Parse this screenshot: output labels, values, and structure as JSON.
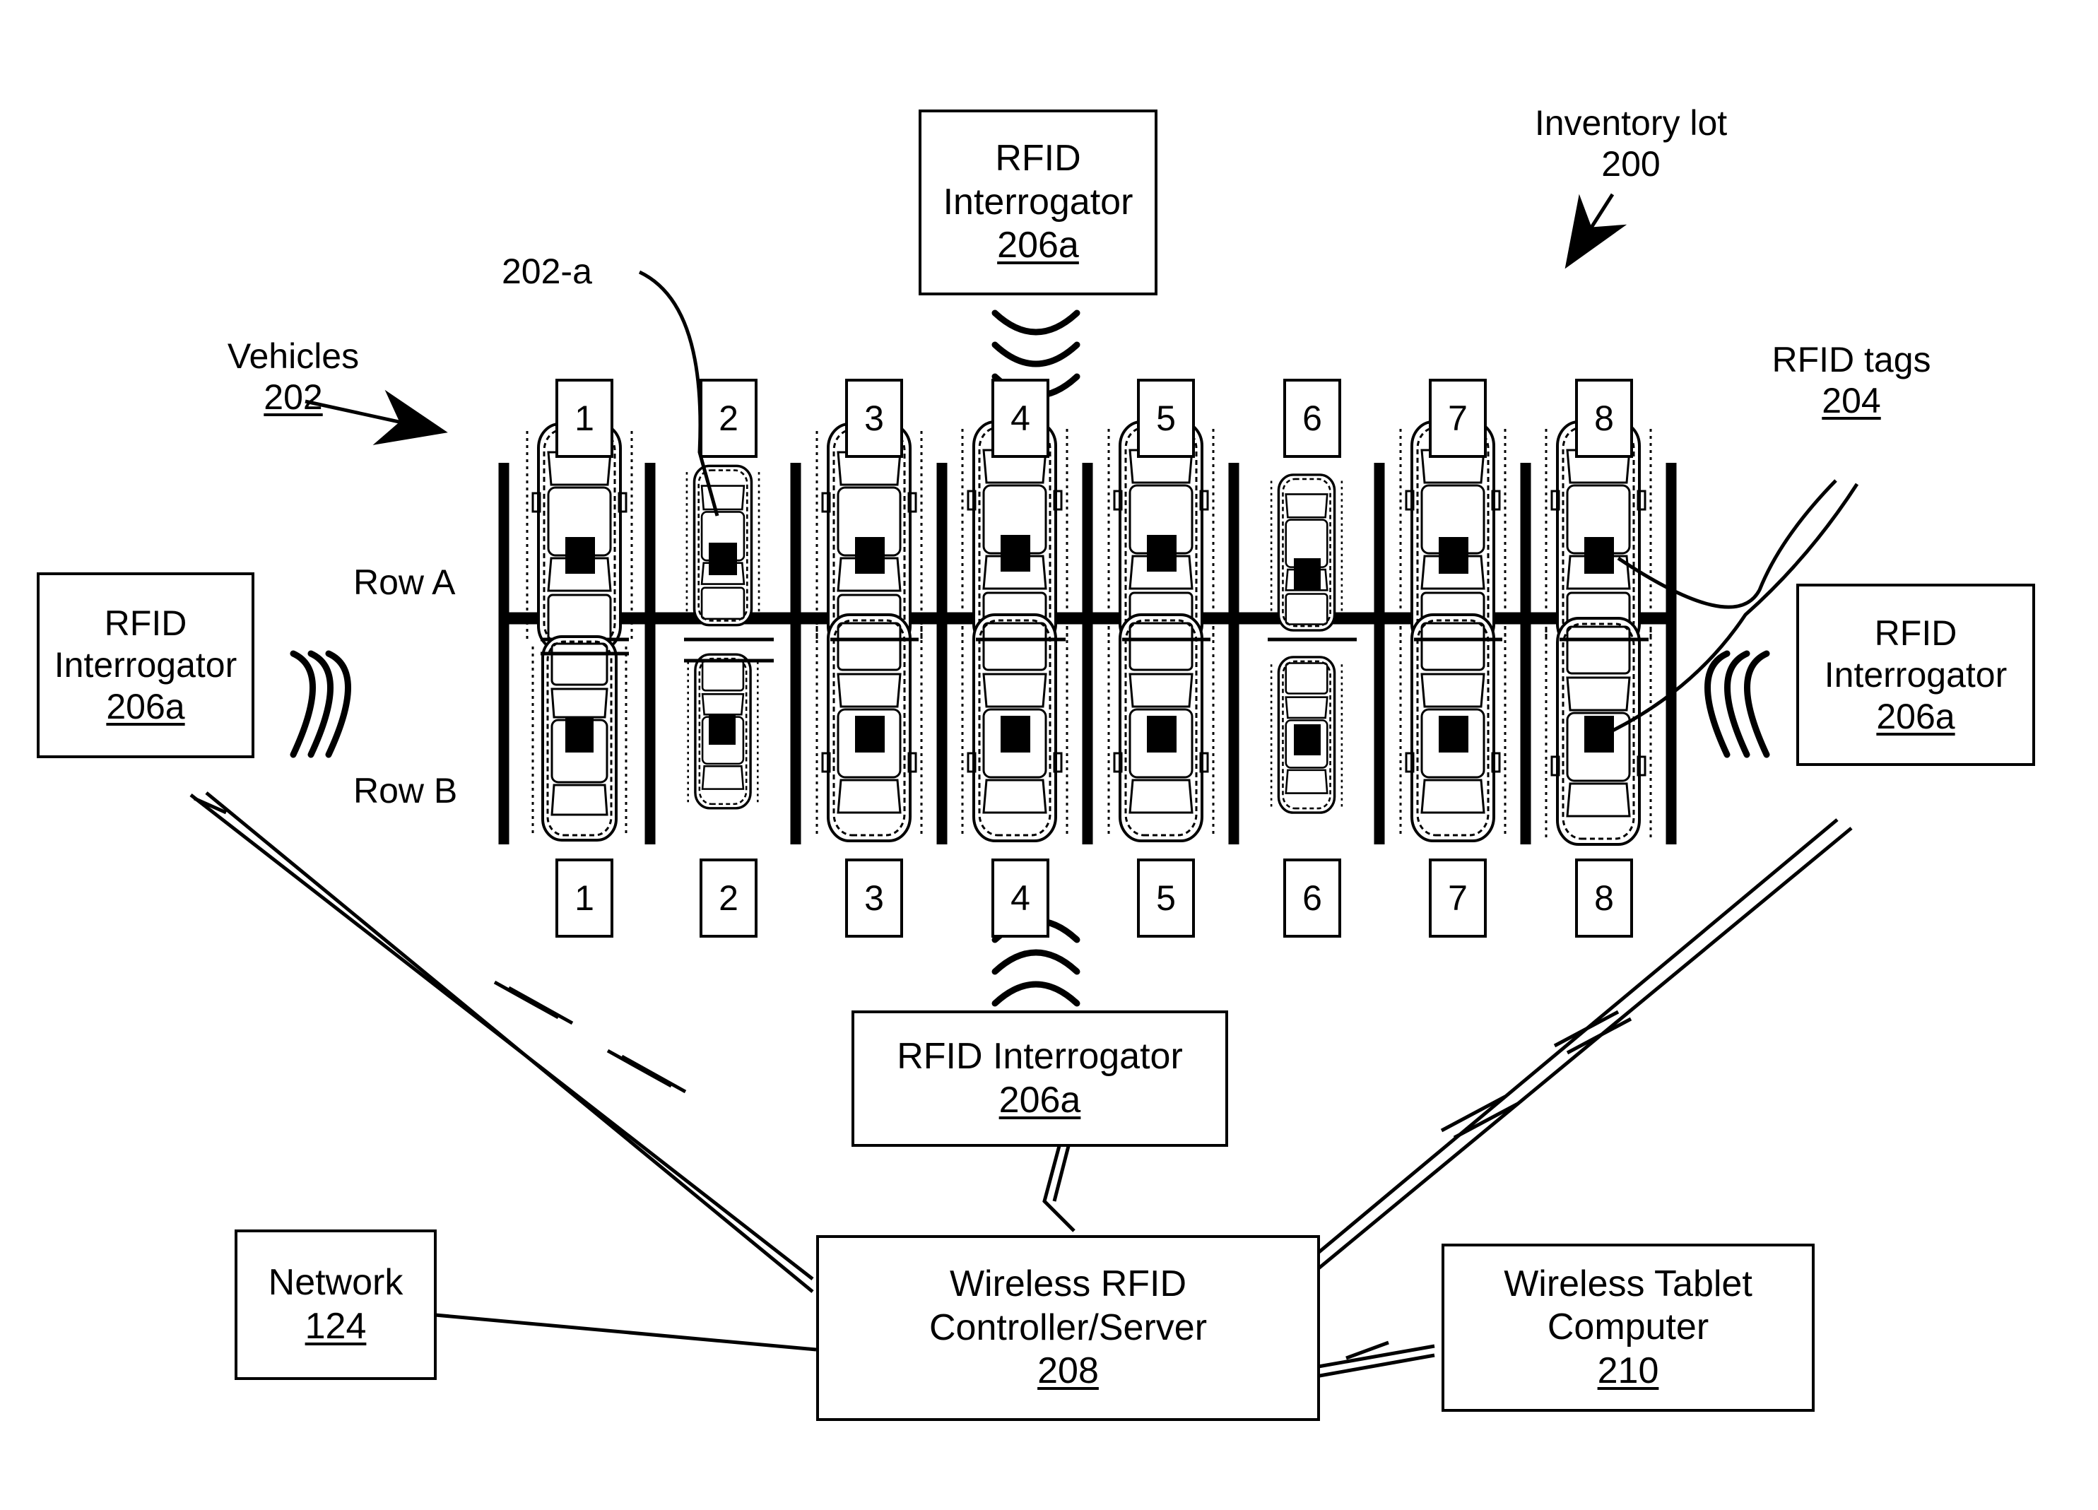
{
  "figure": {
    "title_labels": {
      "inventory_lot": {
        "line1": "Inventory lot",
        "line2": "200"
      },
      "vehicles": {
        "line1": "Vehicles",
        "line2": "202"
      },
      "vehicle_callout": "202-a",
      "rfid_tags": {
        "line1": "RFID tags",
        "line2": "204"
      }
    },
    "rows": [
      {
        "label": "Row A"
      },
      {
        "label": "Row B"
      }
    ],
    "stall_numbers_top": [
      "1",
      "2",
      "3",
      "4",
      "5",
      "6",
      "7",
      "8"
    ],
    "stall_numbers_bottom": [
      "1",
      "2",
      "3",
      "4",
      "5",
      "6",
      "7",
      "8"
    ],
    "boxes": {
      "interrogator_top": {
        "line1": "RFID",
        "line2": "Interrogator",
        "ref": "206a"
      },
      "interrogator_left": {
        "line1": "RFID",
        "line2": "Interrogator",
        "ref": "206a"
      },
      "interrogator_right": {
        "line1": "RFID",
        "line2": "Interrogator",
        "ref": "206a"
      },
      "interrogator_bottom": {
        "line1": "RFID Interrogator",
        "ref": "206a"
      },
      "network": {
        "line1": "Network",
        "ref": "124"
      },
      "server": {
        "line1": "Wireless RFID",
        "line2": "Controller/Server",
        "ref": "208"
      },
      "tablet": {
        "line1": "Wireless Tablet",
        "line2": "Computer",
        "ref": "210"
      }
    },
    "colors": {
      "ink": "#000000",
      "paper": "#ffffff"
    }
  },
  "chart_data": {
    "type": "diagram",
    "title": "RFID vehicle inventory lot diagram",
    "lot_grid": {
      "columns": 8,
      "rows": 2,
      "row_labels": [
        "Row A",
        "Row B"
      ],
      "column_labels": [
        "1",
        "2",
        "3",
        "4",
        "5",
        "6",
        "7",
        "8"
      ]
    },
    "vehicles": [
      {
        "row": "A",
        "stall": 1,
        "size": "large",
        "tagged": true
      },
      {
        "row": "A",
        "stall": 2,
        "size": "small",
        "tagged": true
      },
      {
        "row": "A",
        "stall": 3,
        "size": "large",
        "tagged": true
      },
      {
        "row": "A",
        "stall": 4,
        "size": "large",
        "tagged": true
      },
      {
        "row": "A",
        "stall": 5,
        "size": "large",
        "tagged": true
      },
      {
        "row": "A",
        "stall": 6,
        "size": "small",
        "tagged": true
      },
      {
        "row": "A",
        "stall": 7,
        "size": "large",
        "tagged": true
      },
      {
        "row": "A",
        "stall": 8,
        "size": "large",
        "tagged": true
      },
      {
        "row": "B",
        "stall": 1,
        "size": "medium",
        "tagged": true
      },
      {
        "row": "B",
        "stall": 2,
        "size": "small",
        "tagged": true
      },
      {
        "row": "B",
        "stall": 3,
        "size": "large",
        "tagged": true
      },
      {
        "row": "B",
        "stall": 4,
        "size": "large",
        "tagged": true
      },
      {
        "row": "B",
        "stall": 5,
        "size": "large",
        "tagged": true
      },
      {
        "row": "B",
        "stall": 6,
        "size": "small",
        "tagged": true
      },
      {
        "row": "B",
        "stall": 7,
        "size": "large",
        "tagged": true
      },
      {
        "row": "B",
        "stall": 8,
        "size": "large",
        "tagged": true
      }
    ],
    "interrogators": 4,
    "links": [
      {
        "from": "interrogator_left",
        "to": "server"
      },
      {
        "from": "interrogator_right",
        "to": "server"
      },
      {
        "from": "interrogator_bottom",
        "to": "server"
      },
      {
        "from": "network",
        "to": "server"
      },
      {
        "from": "tablet",
        "to": "server"
      }
    ]
  }
}
